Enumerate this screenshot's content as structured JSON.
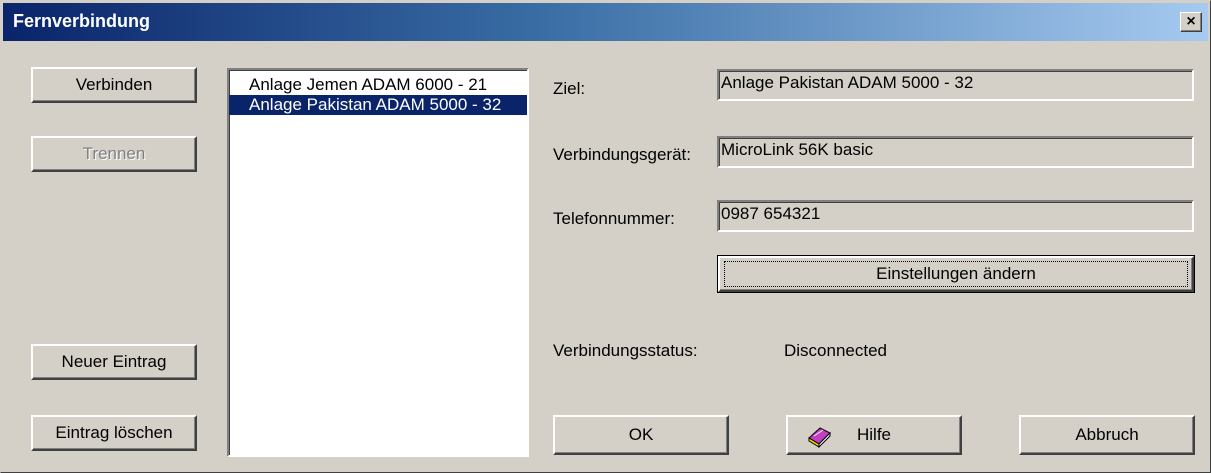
{
  "window": {
    "title": "Fernverbindung",
    "close_label": "×"
  },
  "left_buttons": {
    "connect": "Verbinden",
    "disconnect": "Trennen",
    "new_entry": "Neuer Eintrag",
    "delete_entry": "Eintrag löschen"
  },
  "entries": [
    {
      "label": "Anlage Jemen ADAM 6000 - 21",
      "selected": false
    },
    {
      "label": "Anlage Pakistan ADAM 5000 - 32",
      "selected": true
    }
  ],
  "details": {
    "target_label": "Ziel:",
    "target_value": "Anlage Pakistan ADAM 5000 - 32",
    "device_label": "Verbindungsgerät:",
    "device_value": "MicroLink 56K basic",
    "phone_label": "Telefonnummer:",
    "phone_value": "0987 654321",
    "settings_button": "Einstellungen ändern",
    "status_label": "Verbindungsstatus:",
    "status_value": "Disconnected"
  },
  "bottom_buttons": {
    "ok": "OK",
    "help": "Hilfe",
    "cancel": "Abbruch"
  },
  "icons": {
    "help": "help-book-icon"
  },
  "colors": {
    "title_start": "#0a246a",
    "title_end": "#a6caf0",
    "face": "#d4d0c8",
    "selection": "#0a246a"
  }
}
